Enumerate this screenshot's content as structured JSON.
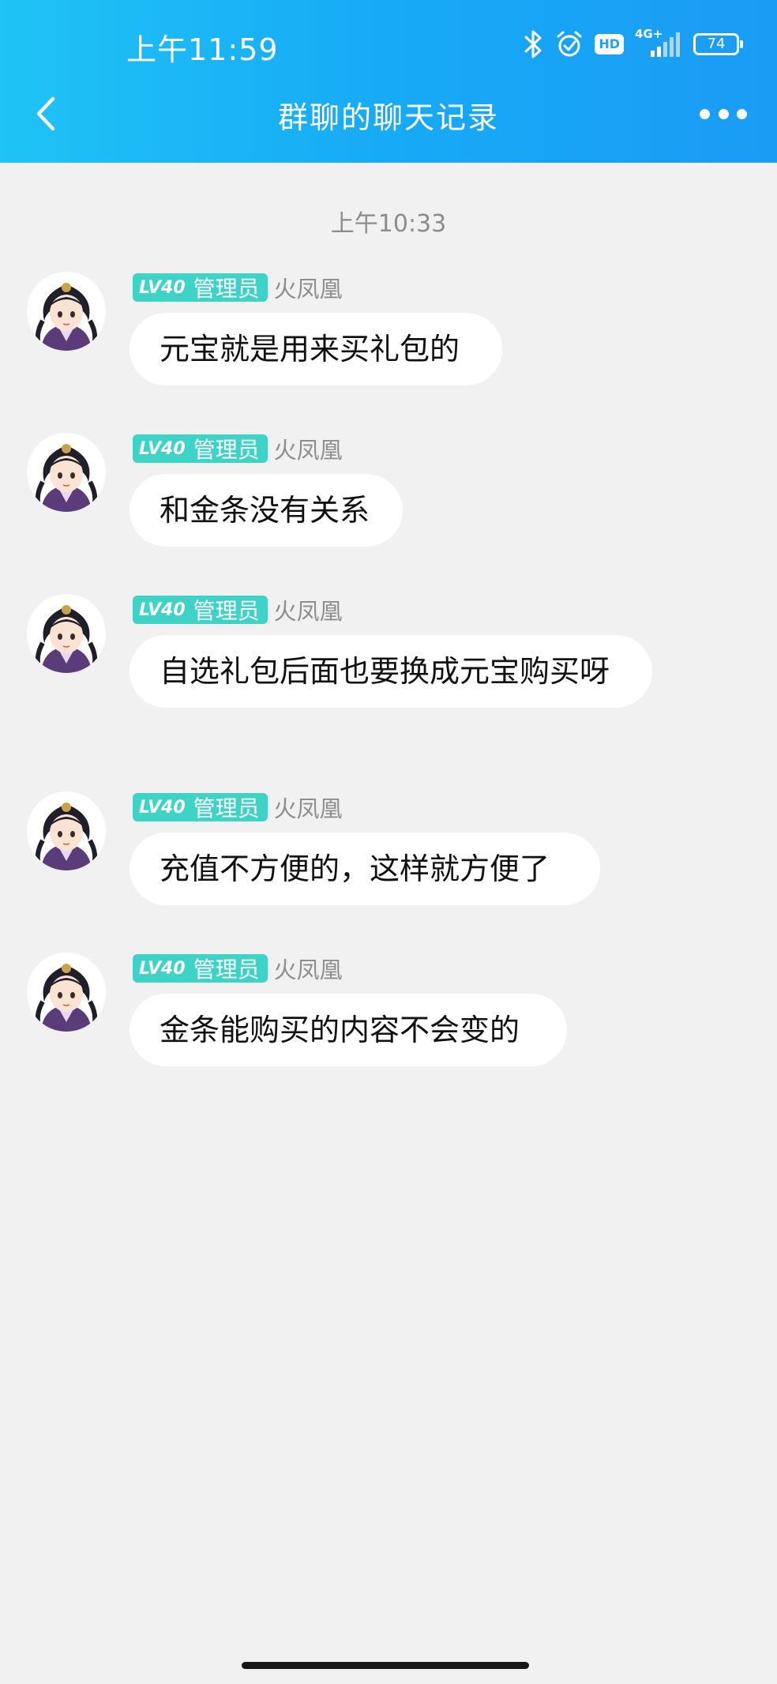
{
  "status_bar": {
    "time": "上午11:59",
    "network": "4G+",
    "hd": "HD",
    "battery": "74"
  },
  "header": {
    "title": "群聊的聊天记录"
  },
  "timestamp": "上午10:33",
  "messages": [
    {
      "level": "LV40",
      "role": "管理员",
      "sender": "火凤凰",
      "text": "元宝就是用来买礼包的"
    },
    {
      "level": "LV40",
      "role": "管理员",
      "sender": "火凤凰",
      "text": "和金条没有关系"
    },
    {
      "level": "LV40",
      "role": "管理员",
      "sender": "火凤凰",
      "text": "自选礼包后面也要换成元宝购买呀"
    },
    {
      "level": "LV40",
      "role": "管理员",
      "sender": "火凤凰",
      "text": "充值不方便的，这样就方便了"
    },
    {
      "level": "LV40",
      "role": "管理员",
      "sender": "火凤凰",
      "text": "金条能购买的内容不会变的"
    }
  ],
  "colors": {
    "header_gradient_start": "#1fc3f5",
    "header_gradient_end": "#1a9cf5",
    "badge": "#3fd3c8",
    "background": "#f1f1f1"
  },
  "icons": [
    "back-arrow-icon",
    "more-dots-icon",
    "bluetooth-icon",
    "alarm-icon",
    "signal-icon",
    "battery-icon"
  ]
}
